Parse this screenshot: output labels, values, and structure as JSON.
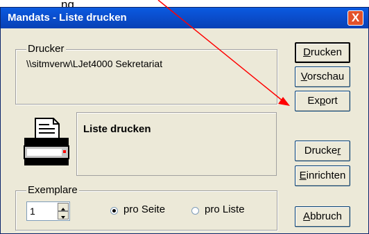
{
  "overlay": {
    "partial_text": "ng"
  },
  "window": {
    "title": "Mandats - Liste drucken",
    "close_glyph": "X"
  },
  "printer_group": {
    "legend": "Drucker",
    "printer_name": "\\\\sitmverw\\LJet4000 Sekretariat"
  },
  "info_panel": {
    "heading": "Liste drucken",
    "icon": "printer-icon"
  },
  "copies_group": {
    "legend": "Exemplare",
    "count_value": "1",
    "radio_options": [
      {
        "label": "pro Seite",
        "selected": true
      },
      {
        "label": "pro Liste",
        "selected": false
      }
    ]
  },
  "buttons": {
    "drucken": {
      "label_first": "D",
      "label_rest": "rucken"
    },
    "vorschau": {
      "label_first": "V",
      "label_rest": "orschau"
    },
    "export": {
      "label_a": "Ex",
      "label_u": "p",
      "label_b": "ort"
    },
    "drucker": {
      "label_a": "Drucke",
      "label_u": "r"
    },
    "einrichten": {
      "label_first": "E",
      "label_rest": "inrichten"
    },
    "abbruch": {
      "label_first": "A",
      "label_rest": "bbruch"
    }
  },
  "colors": {
    "titlebar": "#0a4fcf",
    "dialog_bg": "#ece9d8",
    "arrow": "#ff0000",
    "close": "#e2522a"
  }
}
